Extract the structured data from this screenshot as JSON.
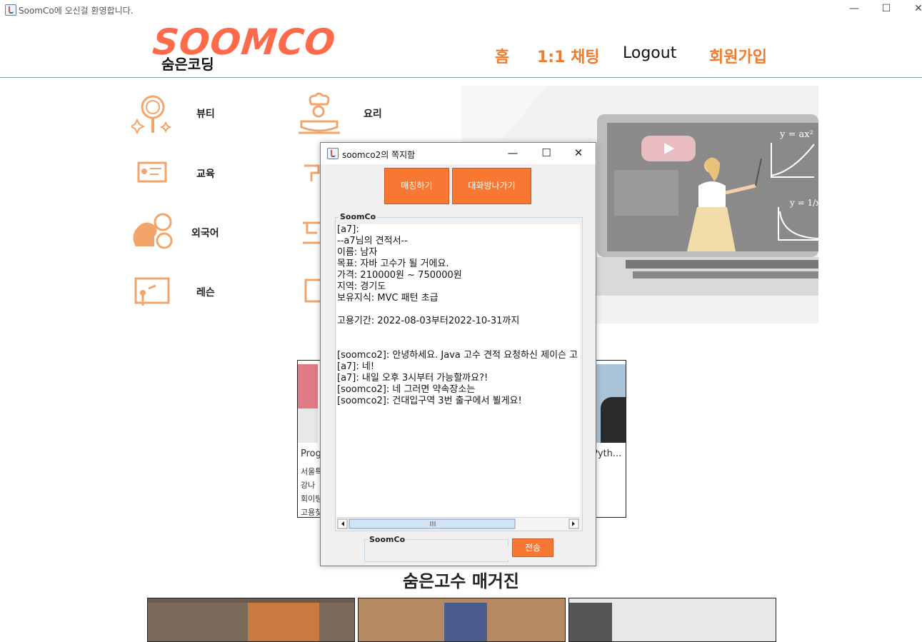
{
  "window": {
    "title": "SoomCo에 오신걸 환영합니다.",
    "controls": [
      "—",
      "☐",
      "✕"
    ]
  },
  "header": {
    "logo_main": "SOOMCO",
    "logo_sub": "숨은코딩",
    "nav": {
      "home": "홈",
      "chat": "1:1 채팅",
      "logout": "Logout",
      "signup": "회원가입"
    }
  },
  "categories": [
    {
      "label": "뷰티",
      "icon": "beauty-mirror-icon"
    },
    {
      "label": "요리",
      "icon": "chef-icon"
    },
    {
      "label": "교육",
      "icon": "education-board-icon"
    },
    {
      "label": "외국어",
      "icon": "foreign-language-icon"
    },
    {
      "label": "레슨",
      "icon": "lesson-board-icon"
    }
  ],
  "card_left": {
    "title": "Prog",
    "lines": [
      "서울특",
      "강나",
      "회이팅",
      "고용찾"
    ]
  },
  "card_right": {
    "title": "Pyth..."
  },
  "magazine": {
    "title": "숨은고수 매거진"
  },
  "dialog": {
    "title": "soomco2의 쪽지함",
    "controls": [
      "—",
      "☐",
      "✕"
    ],
    "match_button": "매칭하기",
    "leave_button": "대화방나가기",
    "chat_group_label": "SoomCo",
    "chat_lines": [
      "[a7]:",
      "--a7님의 견적서--",
      "이름: 남자",
      "목표: 자바 고수가 될 거에요.",
      "가격: 210000원 ~ 750000원",
      "지역: 경기도",
      "보유지식: MVC 패턴 초급",
      "",
      "고용기간: 2022-08-03부터2022-10-31까지",
      "",
      "",
      "[soomco2]: 안녕하세요. Java 고수 견적 요청하신 제이슨 고",
      "[a7]: 네!",
      "[a7]: 내일 오후 3시부터 가능할까요?!",
      "[soomco2]: 네 그러면 약속장소는",
      "[soomco2]: 건대입구역 3번 출구에서 뵐게요!"
    ],
    "input_group_label": "SoomCo",
    "input_value": "",
    "send_button": "전송"
  },
  "colors": {
    "accent": "#f77733",
    "logo": "#ff6b4a",
    "nav": "#f07a2e"
  }
}
